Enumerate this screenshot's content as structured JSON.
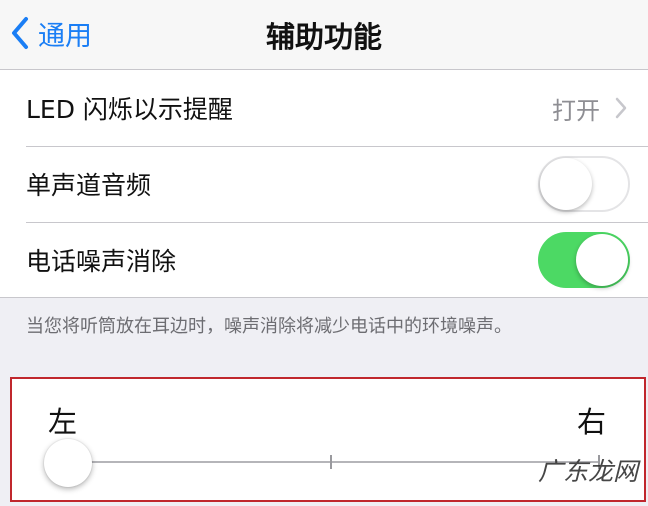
{
  "navbar": {
    "back_label": "通用",
    "title": "辅助功能",
    "accent_color": "#1a7ef5"
  },
  "settings": {
    "rows": [
      {
        "label": "LED 闪烁以示提醒",
        "value": "打开",
        "icon": "chevron-right-icon"
      },
      {
        "label": "单声道音频",
        "toggle": "off"
      },
      {
        "label": "电话噪声消除",
        "toggle": "on"
      }
    ],
    "toggle_on_color": "#4cd964"
  },
  "footnote": "当您将听筒放在耳边时，噪声消除将减少电话中的环境噪声。",
  "balance": {
    "left_label": "左",
    "right_label": "右",
    "slider_value": 0,
    "highlight_color": "#c0272d"
  },
  "watermark": "广东龙网"
}
